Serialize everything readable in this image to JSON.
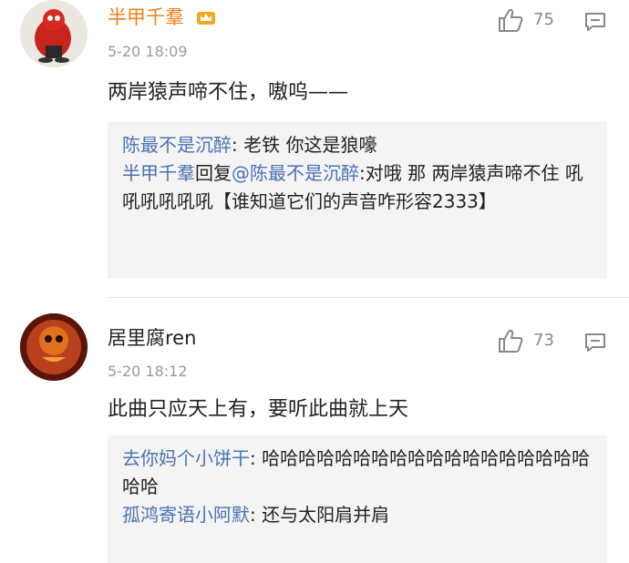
{
  "comments": [
    {
      "username": "半甲千羣",
      "time": "5-20 18:09",
      "likes": "75",
      "text": "两岸猿声啼不住，嗷呜——",
      "replies": [
        {
          "name": "陈最不是沉醉",
          "sep": ": ",
          "text": "老铁 你这是狼嚎"
        },
        {
          "name": "半甲千羣",
          "mid": "回复",
          "at": "@陈最不是沉醉",
          "sep": ":",
          "text": "对哦 那 两岸猿声啼不住 吼吼吼吼吼吼【谁知道它们的声音咋形容2333】"
        }
      ]
    },
    {
      "username": "居里腐ren",
      "time": "5-20 18:12",
      "likes": "73",
      "text": "此曲只应天上有，要听此曲就上天",
      "replies": [
        {
          "name": "去你妈个小饼干",
          "sep": ": ",
          "text": "哈哈哈哈哈哈哈哈哈哈哈哈哈哈哈哈哈哈哈哈"
        },
        {
          "name": "孤鸿寄语小阿默",
          "sep": ": ",
          "text": "还与太阳肩并肩"
        }
      ]
    }
  ],
  "icons": {
    "like": "thumbs-up-icon",
    "reply": "comment-icon",
    "badge": "vip-crown-icon"
  },
  "colors": {
    "vip_name": "#f0801a",
    "reply_name": "#4a72b2",
    "meta": "#9a9a9a"
  }
}
